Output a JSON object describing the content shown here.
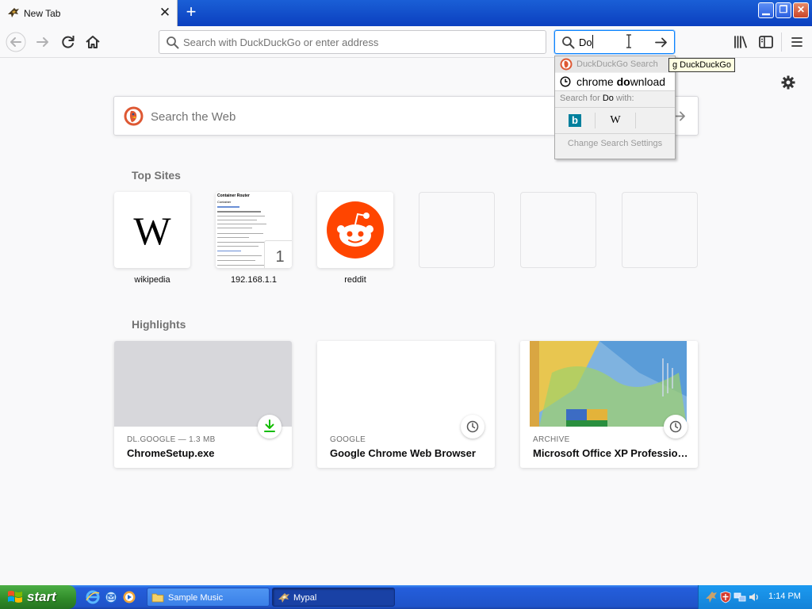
{
  "browser": {
    "tab": {
      "title": "New Tab",
      "close_glyph": "✕"
    },
    "new_tab_glyph": "+",
    "window_controls": {
      "minimize": "▁",
      "restore": "❐",
      "close": "✕"
    },
    "url_bar": {
      "placeholder": "Search with DuckDuckGo or enter address",
      "value": ""
    },
    "search_bar": {
      "value": "Do"
    },
    "search_dropdown": {
      "engine_label": "DuckDuckGo Search",
      "suggestion_prefix": "chrome ",
      "suggestion_match": "do",
      "suggestion_suffix": "wnload",
      "search_for_prefix": "Search for ",
      "search_for_term": "Do",
      "search_for_suffix": " with:",
      "engines": [
        {
          "name": "bing-icon",
          "glyph": "b"
        },
        {
          "name": "wikipedia-icon",
          "glyph": "W"
        }
      ],
      "settings_label": "Change Search Settings"
    },
    "tooltip": "g DuckDuckGo"
  },
  "newtab": {
    "web_search_placeholder": "Search the Web",
    "top_sites_title": "Top Sites",
    "top_sites": [
      {
        "label": "wikipedia"
      },
      {
        "label": "192.168.1.1",
        "badge": "1"
      },
      {
        "label": "reddit"
      },
      {
        "label": ""
      },
      {
        "label": ""
      },
      {
        "label": ""
      }
    ],
    "highlights_title": "Highlights",
    "highlights": [
      {
        "meta": "DL.GOOGLE — 1.3 MB",
        "title": "ChromeSetup.exe",
        "badge_icon": "download-icon"
      },
      {
        "meta": "GOOGLE",
        "title": "Google Chrome Web Browser",
        "badge_icon": "history-icon"
      },
      {
        "meta": "ARCHIVE",
        "title": "Microsoft Office XP Profession...",
        "badge_icon": "history-icon"
      }
    ],
    "thumb_page": {
      "heading": "Container Router",
      "subheading": "Container"
    }
  },
  "taskbar": {
    "start_label": "start",
    "tasks": [
      {
        "label": "Sample Music",
        "icon": "folder-icon"
      },
      {
        "label": "Mypal",
        "icon": "mypal-icon"
      }
    ],
    "clock": "1:14 PM"
  },
  "colors": {
    "accent": "#0a84ff",
    "reddit": "#ff4500",
    "download_green": "#12bc00",
    "xp_blue": "#245edb"
  }
}
